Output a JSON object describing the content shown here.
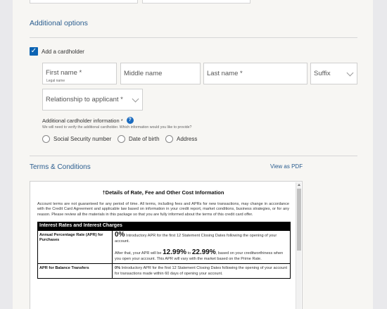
{
  "additional_options": {
    "title": "Additional options",
    "add_cardholder_label": "Add a cardholder",
    "add_cardholder_checked": true,
    "first_name_label": "First name *",
    "first_name_sub": "Legal name",
    "middle_name_label": "Middle name",
    "last_name_label": "Last name *",
    "suffix_label": "Suffix",
    "relationship_label": "Relationship to applicant *",
    "info_label": "Additional cardholder information *",
    "info_note": "We will need to verify the additional cardholder. Which information would you like to provide?",
    "options": [
      "Social Security number",
      "Date of birth",
      "Address"
    ]
  },
  "terms": {
    "title": "Terms & Conditions",
    "pdf_link": "View as PDF",
    "heading": "†Details of Rate, Fee and Other Cost Information",
    "paragraph": "Account terms are not guaranteed for any period of time. All terms, including fees and APRs for new transactions, may change in accordance with the Credit Card Agreement and applicable law based on information in your credit report, market conditions, business strategies, or for any reason. Please review all the materials in this package so that you are fully informed about the terms of this credit card offer.",
    "table_header": "Interest Rates and Interest Charges",
    "rows": [
      {
        "label": "Annual Percentage Rate (APR) for Purchases",
        "rate": "0%",
        "intro_text": "Introductory APR for the first 12 Statement Closing Dates following the opening of your account.",
        "after_text": "After that, your APR will be",
        "rate_low": "12.99%",
        "to_text": "to",
        "rate_high": "22.99%",
        "after_text2": ", based on your creditworthiness when you open your account. This APR will vary with the market based on the Prime Rate."
      },
      {
        "label": "APR for Balance Transfers",
        "rate": "0%",
        "intro_text": "Introductory APR for the first 12 Statement Closing Dates following the opening of your account for transactions made within 60 days of opening your account."
      }
    ]
  },
  "colors": {
    "accent": "#2a5d8f",
    "checkbox": "#0c64b3",
    "help_icon": "#1b6bbf"
  }
}
